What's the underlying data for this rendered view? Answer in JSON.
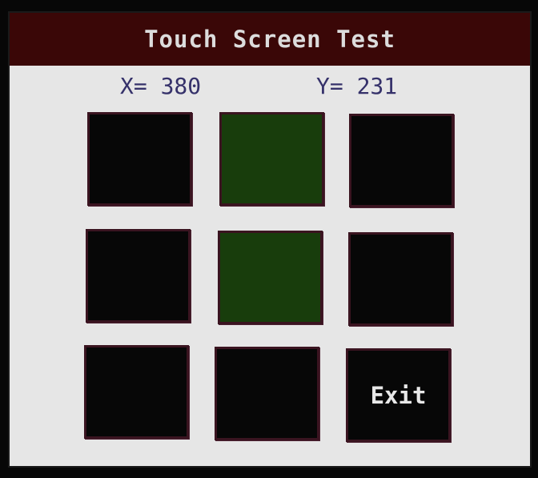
{
  "title": "Touch Screen Test",
  "coords": {
    "x_text": "X= 380",
    "y_text": "Y= 231"
  },
  "buttons": [
    {
      "label": "",
      "active": false
    },
    {
      "label": "",
      "active": true
    },
    {
      "label": "",
      "active": false
    },
    {
      "label": "",
      "active": false
    },
    {
      "label": "",
      "active": true
    },
    {
      "label": "",
      "active": false
    },
    {
      "label": "",
      "active": false
    },
    {
      "label": "",
      "active": false
    },
    {
      "label": "Exit",
      "active": false
    }
  ],
  "colors": {
    "title_bar": "#3a0707",
    "screen_bg": "#e6e6e6",
    "button_idle": "#070707",
    "button_active": "#183d0c",
    "coord_text": "#35316a"
  }
}
